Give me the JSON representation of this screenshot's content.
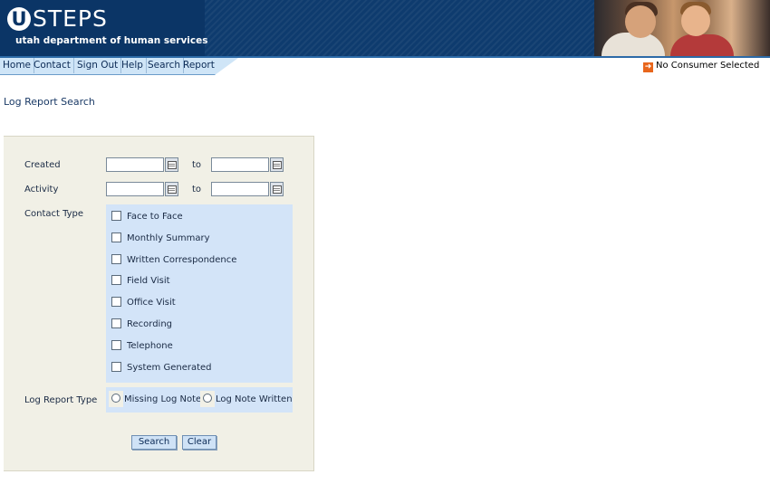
{
  "header": {
    "logo_letter": "U",
    "logo_text": "STEPS",
    "subtitle": "utah department of human services"
  },
  "nav": {
    "items": [
      "Home",
      "Contact",
      "Sign Out",
      "Help",
      "Search",
      "Report"
    ]
  },
  "consumer_status": "No Consumer Selected",
  "page": {
    "title": "Log Report Search"
  },
  "form": {
    "created_label": "Created",
    "activity_label": "Activity",
    "to_label": "to",
    "created_from": "",
    "created_to": "",
    "activity_from": "",
    "activity_to": "",
    "contact_type_label": "Contact Type",
    "contact_types": [
      "Face to Face",
      "Monthly Summary",
      "Written Correspondence",
      "Field Visit",
      "Office Visit",
      "Recording",
      "Telephone",
      "System Generated"
    ],
    "log_report_type_label": "Log Report Type",
    "log_report_types": [
      "Missing Log Note",
      "Log Note Written"
    ],
    "search_button": "Search",
    "clear_button": "Clear"
  },
  "colors": {
    "banner": "#0e3b6e",
    "nav_bg": "#cfe5f7",
    "panel_bg": "#f1f0e6",
    "group_bg": "#d3e4f8",
    "accent_icon": "#e8661c"
  }
}
